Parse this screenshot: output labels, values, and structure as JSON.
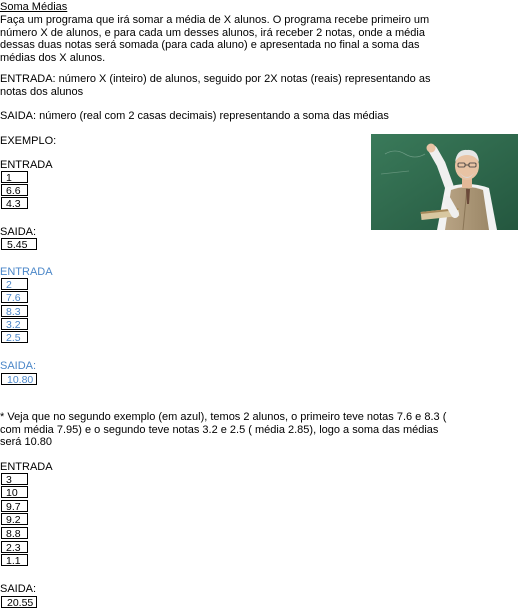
{
  "title": "Soma Médias",
  "description": "Faça um programa que irá somar a média de X alunos. O programa recebe primeiro um número X de alunos, e para cada um desses alunos, irá receber 2 notas, onde a média dessas duas notas será somada (para cada aluno) e apresentada no final a soma das médias dos X alunos.",
  "entrada_desc": "ENTRADA: número X (inteiro) de alunos, seguido por 2X notas (reais) representando as notas dos alunos",
  "saida_desc": "SAIDA: número (real com 2 casas decimais) representando a soma das médias",
  "exemplo_label": "EXEMPLO:",
  "example1": {
    "entrada_label": "ENTRADA",
    "inputs": [
      "1",
      "6.6",
      "4.3"
    ],
    "saida_label": "SAIDA:",
    "output": "5.45"
  },
  "example2": {
    "entrada_label": "ENTRADA",
    "inputs": [
      "2",
      "7.6",
      "8.3",
      "3.2",
      "2.5"
    ],
    "saida_label": "SAIDA:",
    "output": "10.80",
    "color": "#4a86c8"
  },
  "note": "* Veja que no segundo exemplo (em azul), temos 2 alunos, o primeiro teve notas 7.6 e 8.3 ( com média 7.95) e o segundo teve notas 3.2 e 2.5 ( média 2.85), logo a soma das médias será 10.80",
  "example3": {
    "entrada_label": "ENTRADA",
    "inputs": [
      "3",
      "10",
      "9.7",
      "9.2",
      "8.8",
      "2.3",
      "1.1"
    ],
    "saida_label": "SAIDA:",
    "output": "20.55"
  },
  "photo": {
    "board_color": "#2f6b4e",
    "subject": "teacher writing on chalkboard"
  }
}
